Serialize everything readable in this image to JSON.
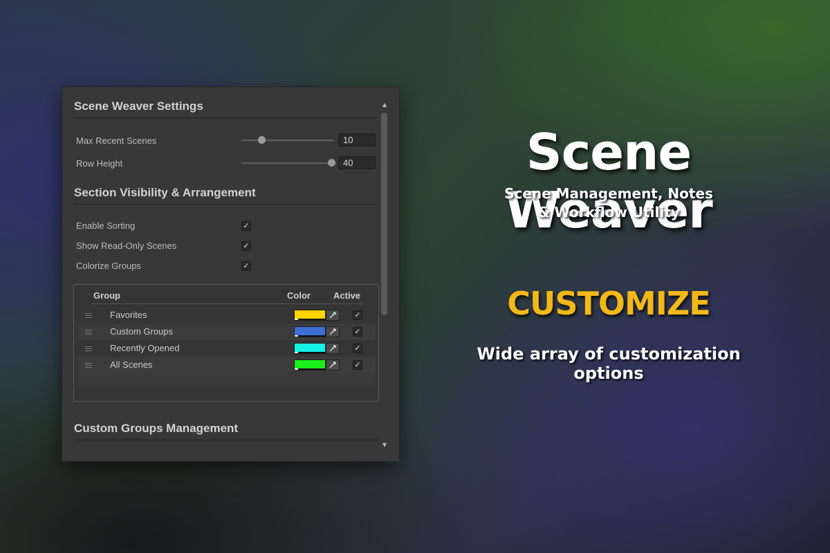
{
  "panel": {
    "settings_header": "Scene Weaver Settings",
    "max_recent": {
      "label": "Max Recent Scenes",
      "value": "10",
      "level": 0.08
    },
    "row_height": {
      "label": "Row Height",
      "value": "40",
      "level": 1.0
    },
    "visibility_header": "Section Visibility & Arrangement",
    "toggles": [
      {
        "label": "Enable Sorting",
        "checked": true
      },
      {
        "label": "Show Read-Only Scenes",
        "checked": true
      },
      {
        "label": "Colorize Groups",
        "checked": true
      }
    ],
    "groups_table": {
      "col_group": "Group",
      "col_color": "Color",
      "col_active": "Active",
      "rows": [
        {
          "name": "Favorites",
          "color": "#ffd400",
          "active": true
        },
        {
          "name": "Custom Groups",
          "color": "#3b6fd6",
          "active": true
        },
        {
          "name": "Recently Opened",
          "color": "#16f2e6",
          "active": true
        },
        {
          "name": "All Scenes",
          "color": "#1bf01b",
          "active": true
        }
      ]
    },
    "custom_groups_header": "Custom Groups Management",
    "check_glyph": "✓",
    "scroll_up_glyph": "▲",
    "scroll_down_glyph": "▼"
  },
  "promo": {
    "title": "Scene Weaver",
    "subtitle_line1": "Scene Management, Notes",
    "subtitle_line2": "& Workflow Utility",
    "section": "CUSTOMIZE",
    "description": "Wide array of customization options",
    "section_color": "#f2b817"
  }
}
